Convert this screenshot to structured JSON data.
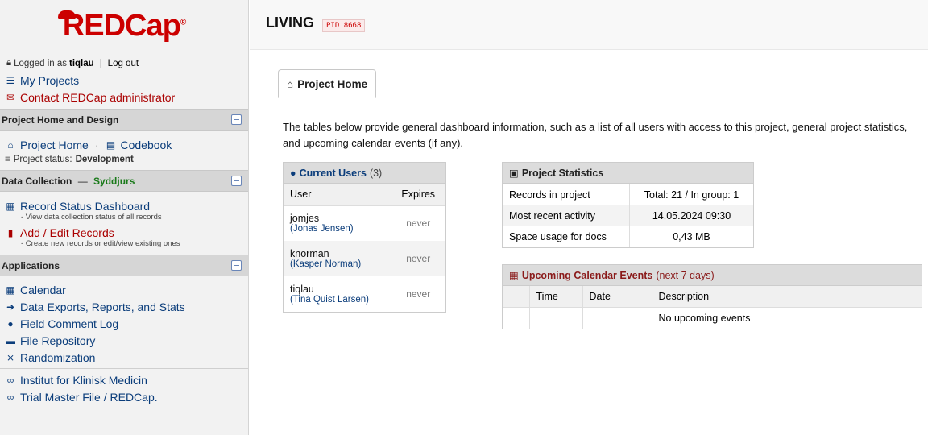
{
  "sidebar": {
    "logo": "REDCap",
    "login": {
      "prefix": "Logged in as",
      "user": "tiqlau",
      "logout": "Log out"
    },
    "links": {
      "my_projects": "My Projects",
      "contact_admin": "Contact REDCap administrator"
    },
    "sections": {
      "project_home_design": {
        "title": "Project Home and Design",
        "project_home": "Project Home",
        "codebook": "Codebook",
        "status_label": "Project status:",
        "status_value": "Development"
      },
      "data_collection": {
        "title": "Data Collection",
        "dag": "Syddjurs",
        "record_status": "Record Status Dashboard",
        "record_status_sub": "- View data collection status of all records",
        "add_edit": "Add / Edit Records",
        "add_edit_sub": "- Create new records or edit/view existing ones"
      },
      "applications": {
        "title": "Applications",
        "items": [
          "Calendar",
          "Data Exports, Reports, and Stats",
          "Field Comment Log",
          "File Repository",
          "Randomization"
        ]
      }
    },
    "bookmarks": [
      "Institut for Klinisk Medicin",
      "Trial Master File / REDCap."
    ]
  },
  "header": {
    "title": "LIVING",
    "pid": "PID 8668"
  },
  "tabs": {
    "project_home": "Project Home"
  },
  "intro": "The tables below provide general dashboard information, such as a list of all users with access to this project, general project statistics, and upcoming calendar events (if any).",
  "current_users": {
    "title": "Current Users",
    "count": "(3)",
    "headers": {
      "user": "User",
      "expires": "Expires"
    },
    "rows": [
      {
        "username": "jomjes",
        "fullname": "(Jonas Jensen)",
        "expires": "never"
      },
      {
        "username": "knorman",
        "fullname": "(Kasper Norman)",
        "expires": "never"
      },
      {
        "username": "tiqlau",
        "fullname": "(Tina Quist Larsen)",
        "expires": "never"
      }
    ]
  },
  "project_statistics": {
    "title": "Project Statistics",
    "rows": [
      {
        "label": "Records in project",
        "value": "Total: 21 / In group: 1"
      },
      {
        "label": "Most recent activity",
        "value": "14.05.2024 09:30"
      },
      {
        "label": "Space usage for docs",
        "value": "0,43 MB"
      }
    ]
  },
  "calendar": {
    "title": "Upcoming Calendar Events",
    "range": "(next 7 days)",
    "headers": {
      "time": "Time",
      "date": "Date",
      "description": "Description"
    },
    "empty": "No upcoming events"
  },
  "colors": {
    "brand_red": "#cc0000",
    "link_blue": "#0b3d7b",
    "dag_green": "#1a7a1a"
  }
}
